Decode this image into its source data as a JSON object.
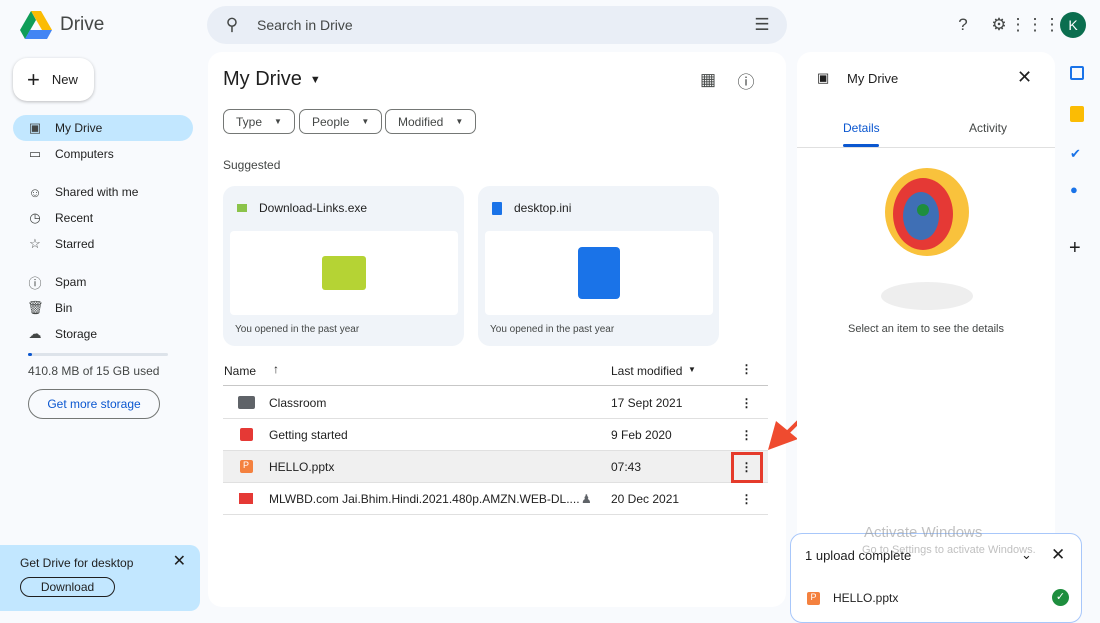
{
  "app": {
    "name": "Drive"
  },
  "search": {
    "placeholder": "Search in Drive"
  },
  "user": {
    "initial": "K"
  },
  "sidebar": {
    "new_label": "New",
    "items": [
      {
        "label": "My Drive",
        "icon": "my-drive-icon"
      },
      {
        "label": "Computers",
        "icon": "computer-icon"
      },
      {
        "label": "Shared with me",
        "icon": "people-icon"
      },
      {
        "label": "Recent",
        "icon": "clock-icon"
      },
      {
        "label": "Starred",
        "icon": "star-icon"
      },
      {
        "label": "Spam",
        "icon": "spam-icon"
      },
      {
        "label": "Bin",
        "icon": "trash-icon"
      },
      {
        "label": "Storage",
        "icon": "cloud-icon"
      }
    ],
    "storage_text": "410.8 MB of 15 GB used",
    "storage_fraction": 0.027,
    "get_storage": "Get more storage"
  },
  "promo": {
    "title": "Get Drive for desktop",
    "button": "Download"
  },
  "main": {
    "title": "My Drive",
    "filters": [
      "Type",
      "People",
      "Modified"
    ],
    "suggested_label": "Suggested",
    "suggested": [
      {
        "name": "Download-Links.exe",
        "sub": "You opened in the past year"
      },
      {
        "name": "desktop.ini",
        "sub": "You opened in the past year"
      }
    ],
    "columns": {
      "name": "Name",
      "modified": "Last modified"
    },
    "files": [
      {
        "name": "Classroom",
        "modified": "17 Sept 2021",
        "icon": "folder-icon"
      },
      {
        "name": "Getting started",
        "modified": "9 Feb 2020",
        "icon": "pdf-icon"
      },
      {
        "name": "HELLO.pptx",
        "modified": "07:43",
        "icon": "pptx-icon"
      },
      {
        "name": "MLWBD.com Jai.Bhim.Hindi.2021.480p.AMZN.WEB-DL....",
        "modified": "20 Dec 2021",
        "icon": "video-icon",
        "shared": true
      }
    ]
  },
  "details": {
    "title": "My Drive",
    "tabs": [
      "Details",
      "Activity"
    ],
    "empty_text": "Select an item to see the details"
  },
  "upload": {
    "title": "1 upload complete",
    "file": "HELLO.pptx"
  },
  "watermark": {
    "line1": "Activate Windows",
    "line2": "Go to Settings to activate Windows."
  },
  "colors": {
    "accent": "#0b57d0",
    "selected_nav": "#c2e7ff",
    "highlight": "#e53b2b"
  }
}
